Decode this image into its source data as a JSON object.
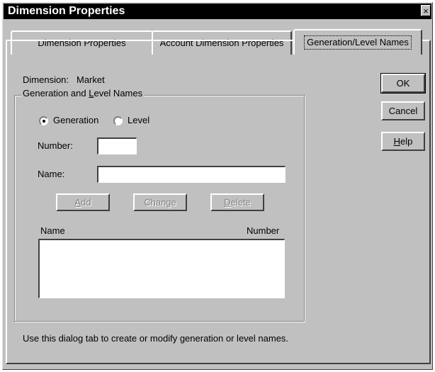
{
  "window": {
    "title": "Dimension Properties",
    "close_glyph": "×"
  },
  "tabs": [
    {
      "label": "Dimension Properties",
      "active": false
    },
    {
      "label": "Account Dimension Properties",
      "active": false
    },
    {
      "label": "Generation/Level Names",
      "active": true
    }
  ],
  "dimension": {
    "label": "Dimension:",
    "value": "Market"
  },
  "group": {
    "legend_pre": "Generation and ",
    "legend_key": "L",
    "legend_post": "evel Names",
    "generation_label": "Generation",
    "level_label": "Level",
    "selected": "Generation",
    "number_label": "Number:",
    "number_value": "",
    "name_label": "Name:",
    "name_value": "",
    "add_key": "A",
    "add_rest": "dd",
    "change_label": "Change",
    "delete_key": "D",
    "delete_rest": "elete",
    "list_header_name": "Name",
    "list_header_number": "Number",
    "list_items": []
  },
  "buttons": {
    "ok_label": "OK",
    "cancel_label": "Cancel",
    "help_key": "H",
    "help_rest": "elp"
  },
  "hint_text": "Use this dialog tab to create or modify generation or level names."
}
